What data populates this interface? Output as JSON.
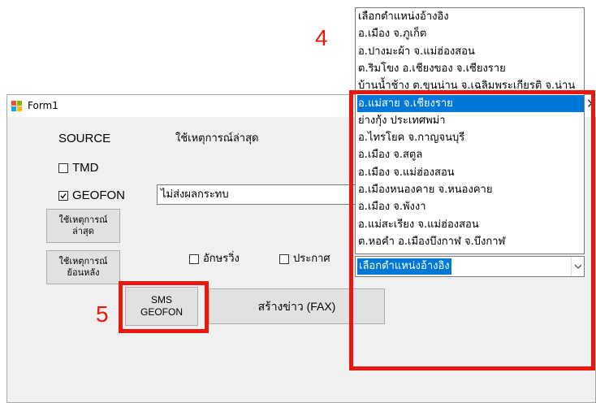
{
  "window": {
    "title": "Form1",
    "close_glyph": "✕"
  },
  "source": {
    "heading": "SOURCE",
    "latest_event_text": "ใช้เหตุการณ์ล่าสุด",
    "tmd_label": "TMD",
    "tmd_checked": false,
    "geofon_label": "GEOFON",
    "geofon_checked": true,
    "geofon_status_value": "ไม่ส่งผลกระทบ"
  },
  "buttons": {
    "use_latest_label": "ใช้เหตุการณ์ ล่าสุด",
    "use_past_label": "ใช้เหตุการณ์ ย้อนหลัง",
    "sms_label": "SMS GEOFON",
    "create_news_label": "สร้างข่าว (FAX)"
  },
  "options": {
    "running_text_label": "อักษรวิ่ง",
    "running_text_checked": false,
    "announce_label": "ประกาศ",
    "announce_checked": false
  },
  "reference_combo": {
    "selected_value": "เลือกตำแหน่งอ้างอิง",
    "items": [
      "เลือกตำแหน่งอ้างอิง",
      "อ.เมือง จ.ภูเก็ต",
      "อ.ปางมะผ้า จ.แม่ฮ่องสอน",
      "ต.ริมโขง อ.เชียงของ จ.เชียงราย",
      "บ้านน้ำช้าง ต.ขุนน่าน จ.เฉลิมพระเกียรติ จ.น่าน",
      "อ.แม่สาย จ.เชียงราย",
      "ย่างกุ้ง ประเทศพม่า",
      "อ.ไทรโยค จ.กาญจนบุรี",
      "อ.เมือง จ.สตูล",
      "อ.เมือง จ.แม่ฮ่องสอน",
      "อ.เมืองหนองคาย จ.หนองคาย",
      "อ.เมือง จ.พังงา",
      "อ.แม่สะเรียง จ.แม่ฮ่องสอน",
      "ต.หอคำ อ.เมืองบึงกาฬ จ.บึงกาฬ"
    ],
    "highlighted_index": 5
  },
  "annotations": {
    "step_4": "4",
    "step_5": "5",
    "color": "#e8170f"
  },
  "colors": {
    "selection": "#0078d7",
    "form_bg": "#f0f0f0",
    "button_bg": "#e1e1e1"
  }
}
